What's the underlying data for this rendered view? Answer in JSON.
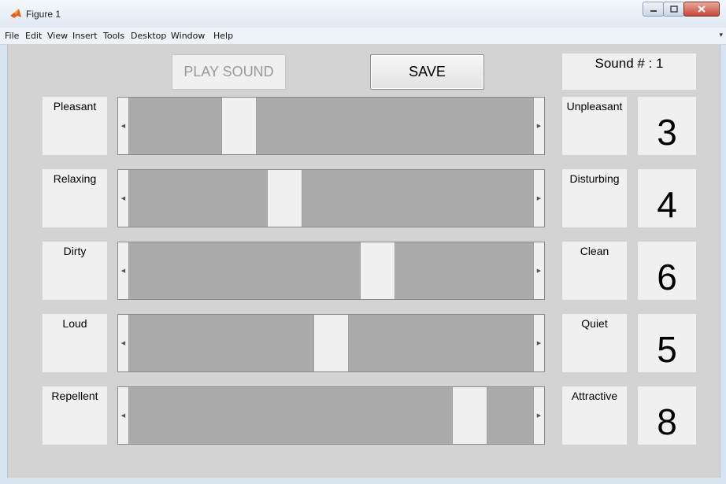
{
  "window": {
    "title": "Figure 1",
    "menu": [
      "File",
      "Edit",
      "View",
      "Insert",
      "Tools",
      "Desktop",
      "Window",
      "Help"
    ]
  },
  "toolbar": {
    "play_label": "PLAY SOUND",
    "save_label": "SAVE"
  },
  "sound": {
    "label": "Sound # : 1"
  },
  "scales": [
    {
      "left": "Pleasant",
      "right": "Unpleasant",
      "value": "3",
      "slider_fraction": 0.25
    },
    {
      "left": "Relaxing",
      "right": "Disturbing",
      "value": "4",
      "slider_fraction": 0.375
    },
    {
      "left": "Dirty",
      "right": "Clean",
      "value": "6",
      "slider_fraction": 0.625
    },
    {
      "left": "Loud",
      "right": "Quiet",
      "value": "5",
      "slider_fraction": 0.5
    },
    {
      "left": "Repellent",
      "right": "Attractive",
      "value": "8",
      "slider_fraction": 0.875
    }
  ]
}
